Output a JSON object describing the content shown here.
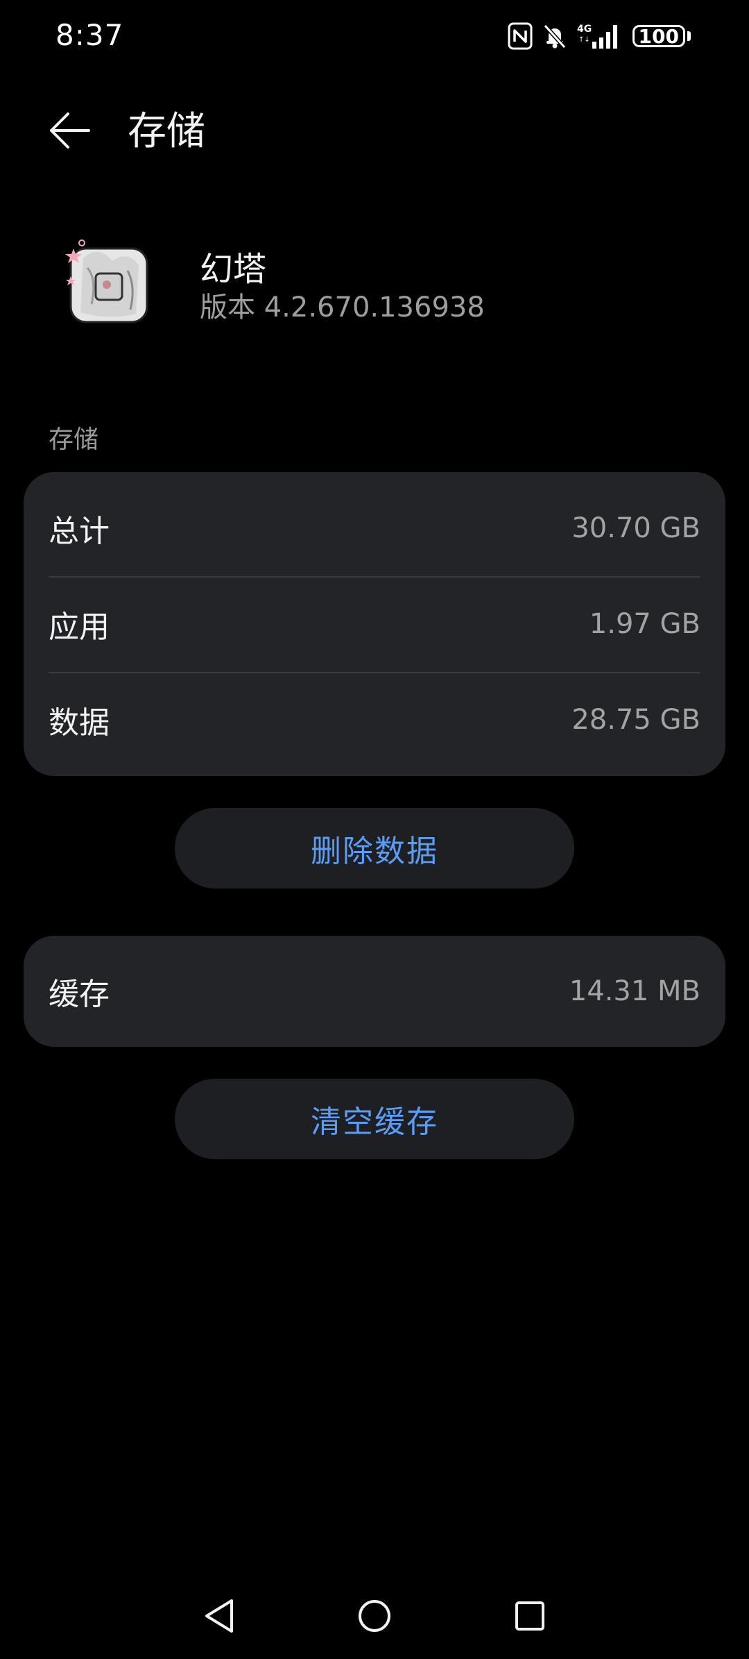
{
  "status_bar": {
    "time": "8:37",
    "network_label": "4G",
    "battery": "100",
    "icons": [
      "nfc-icon",
      "bell-off-icon",
      "cellular-signal-icon",
      "battery-icon"
    ]
  },
  "header": {
    "title": "存储",
    "back_icon": "arrow-left-icon"
  },
  "app": {
    "name": "幻塔",
    "version": "版本 4.2.670.136938"
  },
  "storage_section": {
    "label": "存储",
    "rows": [
      {
        "label": "总计",
        "value": "30.70 GB"
      },
      {
        "label": "应用",
        "value": "1.97 GB"
      },
      {
        "label": "数据",
        "value": "28.75 GB"
      }
    ]
  },
  "delete_data_button": "删除数据",
  "cache": {
    "label": "缓存",
    "value": "14.31 MB"
  },
  "clear_cache_button": "清空缓存",
  "nav": {
    "back_icon": "triangle-back-icon",
    "home_icon": "circle-home-icon",
    "recent_icon": "square-recents-icon"
  },
  "colors": {
    "background": "#000000",
    "card": "#232427",
    "accent": "#5b9cf5",
    "text_primary": "#f2f2f2",
    "text_secondary": "#a3a3a3"
  }
}
